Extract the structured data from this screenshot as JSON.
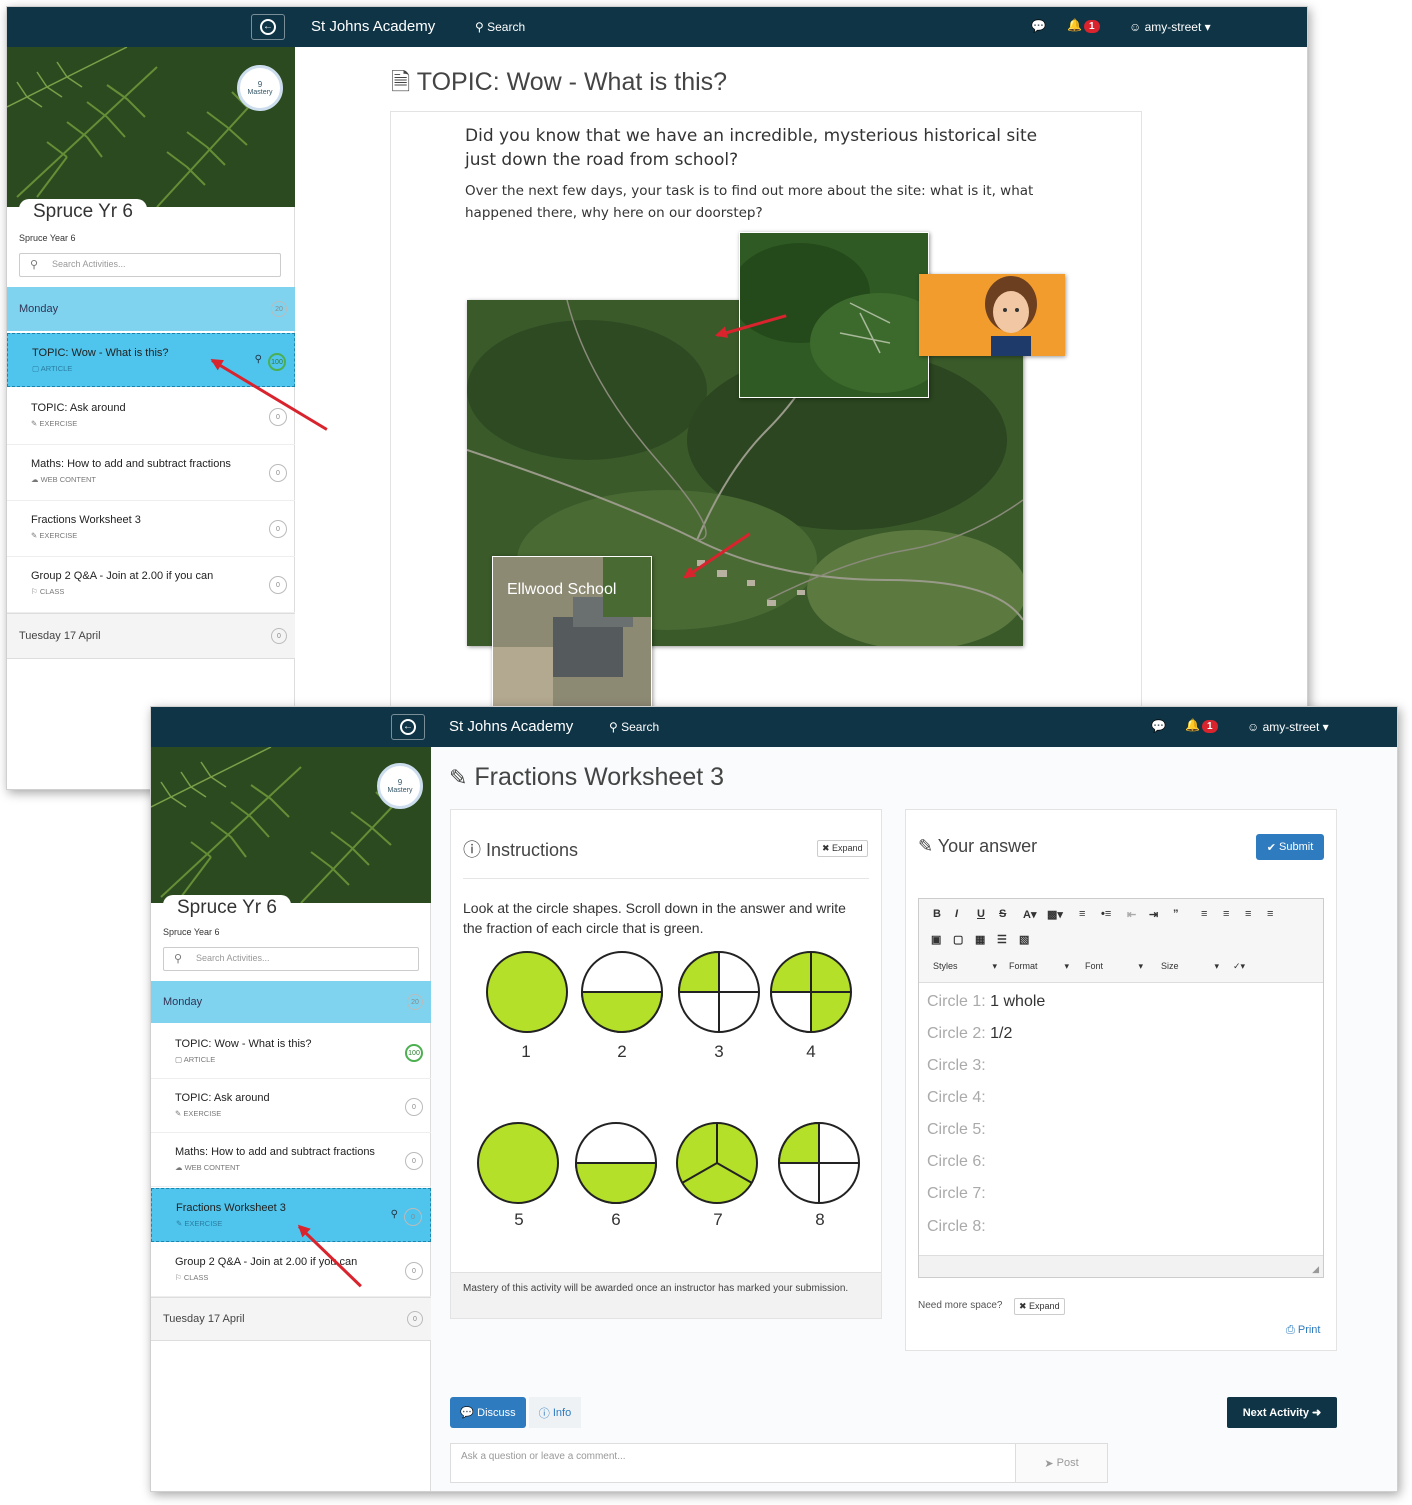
{
  "topbar": {
    "brand": "St Johns Academy",
    "search": "Search",
    "notif_count": "1",
    "user": "amy-street"
  },
  "sidebar": {
    "mastery_value": "9",
    "mastery_label": "Mastery",
    "class_name": "Spruce Yr 6",
    "class_sub": "Spruce Year 6",
    "search_placeholder": "Search Activities...",
    "monday": {
      "label": "Monday",
      "count": "20"
    },
    "tuesday": {
      "label": "Tuesday 17 April",
      "count": "0"
    },
    "items": [
      {
        "title": "TOPIC: Wow - What is this?",
        "type": "ARTICLE",
        "score": "100"
      },
      {
        "title": "TOPIC: Ask around",
        "type": "EXERCISE",
        "score": "0"
      },
      {
        "title": "Maths: How to add and subtract fractions",
        "type": "WEB CONTENT",
        "score": "0"
      },
      {
        "title": "Fractions Worksheet 3",
        "type": "EXERCISE",
        "score": "0"
      },
      {
        "title": "Group 2 Q&A - Join at 2.00 if you can",
        "type": "CLASS",
        "score": "0"
      }
    ]
  },
  "win1": {
    "title": "TOPIC: Wow - What is this?",
    "para1": "Did you know that we have an incredible, mysterious historical site just down the road from school?",
    "para2": "Over the next few days, your task is to find out more about the site: what is it, what happened there, why here on our doorstep?",
    "school_label": "Ellwood School"
  },
  "win2": {
    "title": "Fractions Worksheet 3",
    "instructions_title": "Instructions",
    "expand": "Expand",
    "instructions_text": "Look at the circle shapes. Scroll down in the answer and write the fraction of each circle that is green.",
    "circle_numbers": [
      "1",
      "2",
      "3",
      "4",
      "5",
      "6",
      "7",
      "8"
    ],
    "mastery_note": "Mastery of this activity will be awarded once an instructor has marked your submission.",
    "answer_title": "Your answer",
    "submit": "Submit",
    "toolbar": {
      "styles": "Styles",
      "format": "Format",
      "font": "Font",
      "size": "Size"
    },
    "answers": [
      {
        "label": "Circle 1:",
        "value": "1 whole"
      },
      {
        "label": "Circle 2:",
        "value": "1/2"
      },
      {
        "label": "Circle 3:",
        "value": ""
      },
      {
        "label": "Circle 4:",
        "value": ""
      },
      {
        "label": "Circle 5:",
        "value": ""
      },
      {
        "label": "Circle 6:",
        "value": ""
      },
      {
        "label": "Circle 7:",
        "value": ""
      },
      {
        "label": "Circle 8:",
        "value": ""
      }
    ],
    "need_space": "Need more space?",
    "print": "Print",
    "discuss": "Discuss",
    "info": "Info",
    "next_activity": "Next Activity",
    "comment_placeholder": "Ask a question or leave a comment...",
    "post": "Post"
  },
  "colors": {
    "navbar": "#0e3446",
    "monday": "#7fd3ee",
    "selected": "#4fc4ec",
    "green": "#b5e02a",
    "accent": "#2e7bbf"
  }
}
